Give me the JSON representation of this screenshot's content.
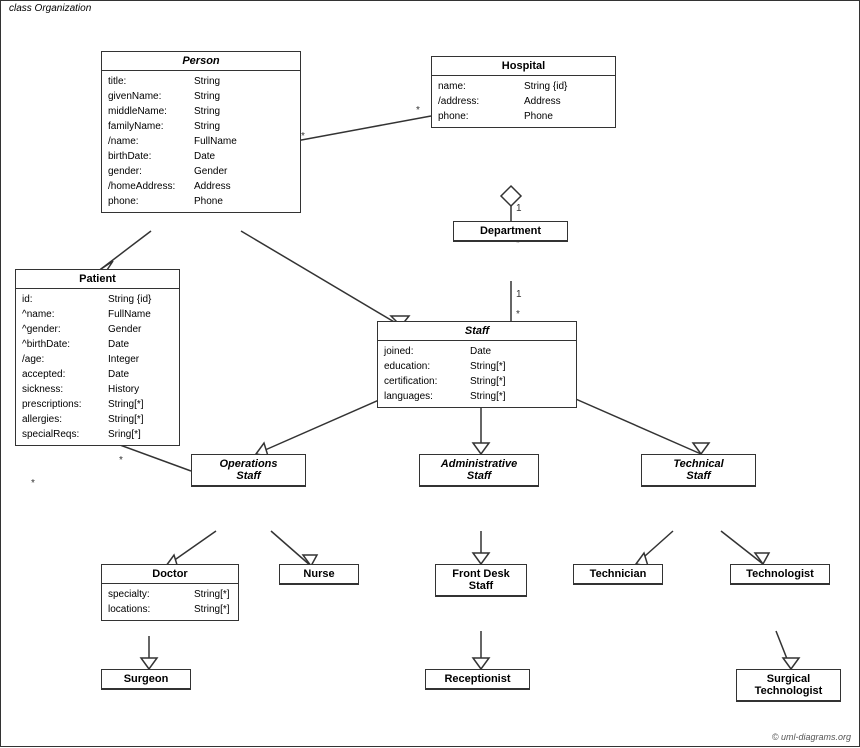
{
  "diagram": {
    "title": "class Organization",
    "classes": {
      "person": {
        "name": "Person",
        "italic": true,
        "attrs": [
          {
            "name": "title:",
            "type": "String"
          },
          {
            "name": "givenName:",
            "type": "String"
          },
          {
            "name": "middleName:",
            "type": "String"
          },
          {
            "name": "familyName:",
            "type": "String"
          },
          {
            "name": "/name:",
            "type": "FullName"
          },
          {
            "name": "birthDate:",
            "type": "Date"
          },
          {
            "name": "gender:",
            "type": "Gender"
          },
          {
            "name": "/homeAddress:",
            "type": "Address"
          },
          {
            "name": "phone:",
            "type": "Phone"
          }
        ]
      },
      "hospital": {
        "name": "Hospital",
        "italic": false,
        "attrs": [
          {
            "name": "name:",
            "type": "String {id}"
          },
          {
            "name": "/address:",
            "type": "Address"
          },
          {
            "name": "phone:",
            "type": "Phone"
          }
        ]
      },
      "patient": {
        "name": "Patient",
        "italic": false,
        "attrs": [
          {
            "name": "id:",
            "type": "String {id}"
          },
          {
            "name": "^name:",
            "type": "FullName"
          },
          {
            "name": "^gender:",
            "type": "Gender"
          },
          {
            "name": "^birthDate:",
            "type": "Date"
          },
          {
            "name": "/age:",
            "type": "Integer"
          },
          {
            "name": "accepted:",
            "type": "Date"
          },
          {
            "name": "sickness:",
            "type": "History"
          },
          {
            "name": "prescriptions:",
            "type": "String[*]"
          },
          {
            "name": "allergies:",
            "type": "String[*]"
          },
          {
            "name": "specialReqs:",
            "type": "Sring[*]"
          }
        ]
      },
      "department": {
        "name": "Department",
        "italic": false,
        "attrs": []
      },
      "staff": {
        "name": "Staff",
        "italic": true,
        "attrs": [
          {
            "name": "joined:",
            "type": "Date"
          },
          {
            "name": "education:",
            "type": "String[*]"
          },
          {
            "name": "certification:",
            "type": "String[*]"
          },
          {
            "name": "languages:",
            "type": "String[*]"
          }
        ]
      },
      "operations_staff": {
        "name": "Operations\nStaff",
        "italic": true,
        "attrs": []
      },
      "administrative_staff": {
        "name": "Administrative\nStaff",
        "italic": true,
        "attrs": []
      },
      "technical_staff": {
        "name": "Technical\nStaff",
        "italic": true,
        "attrs": []
      },
      "doctor": {
        "name": "Doctor",
        "italic": false,
        "attrs": [
          {
            "name": "specialty:",
            "type": "String[*]"
          },
          {
            "name": "locations:",
            "type": "String[*]"
          }
        ]
      },
      "nurse": {
        "name": "Nurse",
        "italic": false,
        "attrs": []
      },
      "front_desk_staff": {
        "name": "Front Desk\nStaff",
        "italic": false,
        "attrs": []
      },
      "technician": {
        "name": "Technician",
        "italic": false,
        "attrs": []
      },
      "technologist": {
        "name": "Technologist",
        "italic": false,
        "attrs": []
      },
      "surgeon": {
        "name": "Surgeon",
        "italic": false,
        "attrs": []
      },
      "receptionist": {
        "name": "Receptionist",
        "italic": false,
        "attrs": []
      },
      "surgical_technologist": {
        "name": "Surgical\nTechnologist",
        "italic": false,
        "attrs": []
      }
    },
    "copyright": "© uml-diagrams.org"
  }
}
